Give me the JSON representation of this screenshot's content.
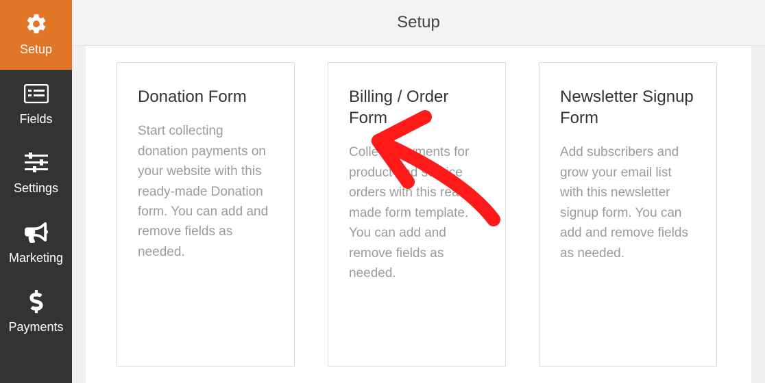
{
  "header": {
    "title": "Setup"
  },
  "sidebar": {
    "items": [
      {
        "icon": "gear",
        "label": "Setup",
        "active": true
      },
      {
        "icon": "list",
        "label": "Fields",
        "active": false
      },
      {
        "icon": "sliders",
        "label": "Settings",
        "active": false
      },
      {
        "icon": "bullhorn",
        "label": "Marketing",
        "active": false
      },
      {
        "icon": "dollar",
        "label": "Payments",
        "active": false
      }
    ]
  },
  "cards": [
    {
      "title": "Donation Form",
      "description": "Start collecting donation payments on your website with this ready-made Donation form. You can add and remove fields as needed."
    },
    {
      "title": "Billing / Order Form",
      "description": "Collect Payments for product and service orders with this ready-made form template. You can add and remove fields as needed."
    },
    {
      "title": "Newsletter Signup Form",
      "description": "Add subscribers and grow your email list with this newsletter signup form. You can add and remove fields as needed."
    }
  ],
  "annotation": {
    "type": "arrow",
    "color": "#ff0000",
    "points_to": "cards.0"
  }
}
